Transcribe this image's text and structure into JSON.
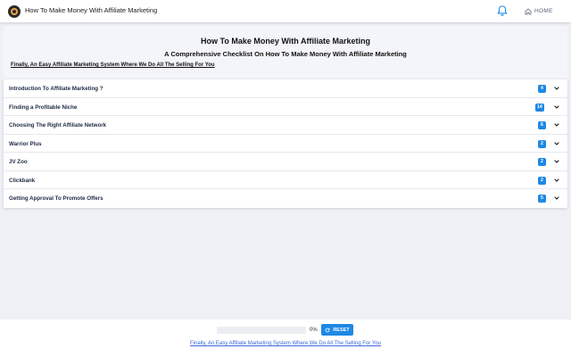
{
  "header": {
    "app_title": "How To Make Money With Affiliate Marketing",
    "home_label": "HOME",
    "icons": {
      "logo": "badge-logo-icon",
      "notifications": "bell-icon",
      "home": "home-icon"
    }
  },
  "hero": {
    "title": "How To Make Money With Affiliate Marketing",
    "subtitle": "A Comprehensive Checklist On How To Make Money With Affiliate Marketing",
    "tagline": "Finally, An Easy Affiliate Marketing System Where We Do All The Selling For You"
  },
  "sections": [
    {
      "label": "Introduction To Affiliate Marketing ?",
      "count": "4"
    },
    {
      "label": "Finding a Profitable Niche",
      "count": "14"
    },
    {
      "label": "Choosing The Right Affiliate Network",
      "count": "6"
    },
    {
      "label": "Warrior Plus",
      "count": "2"
    },
    {
      "label": "JV Zoo",
      "count": "2"
    },
    {
      "label": "Clickbank",
      "count": "2"
    },
    {
      "label": "Getting Approval To Promote Offers",
      "count": "5"
    }
  ],
  "footer": {
    "progress_percent": 0,
    "progress_label": "0%",
    "reset_label": "RESET",
    "link_text": "Finally, An Easy Affiliate Marketing System Where We Do All The Selling For You"
  },
  "colors": {
    "accent": "#1e88e5",
    "background": "#eef0f6",
    "link": "#3b6bd6"
  }
}
